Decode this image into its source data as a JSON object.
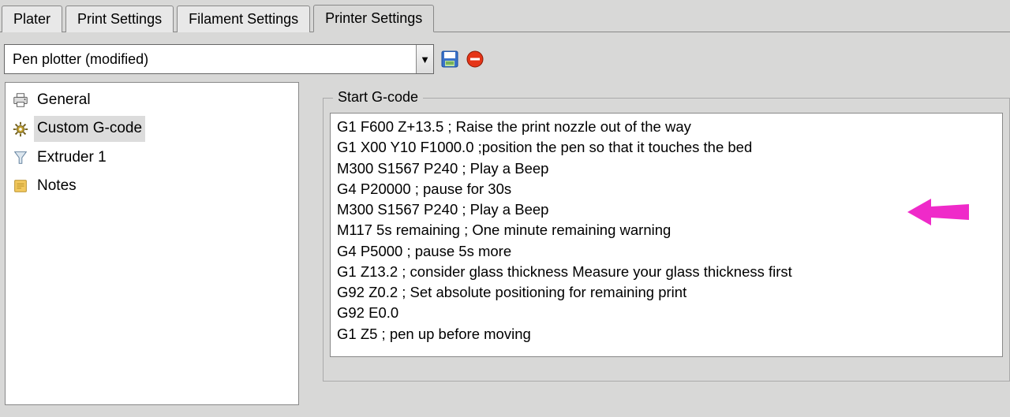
{
  "tabs": {
    "plater": "Plater",
    "print_settings": "Print Settings",
    "filament_settings": "Filament Settings",
    "printer_settings": "Printer Settings"
  },
  "profile": {
    "selected": "Pen plotter (modified)"
  },
  "tree": {
    "general": "General",
    "custom_gcode": "Custom G-code",
    "extruder1": "Extruder 1",
    "notes": "Notes"
  },
  "groupbox": {
    "legend": "Start G-code"
  },
  "gcode": "G1 F600 Z+13.5 ; Raise the print nozzle out of the way\nG1 X00 Y10 F1000.0 ;position the pen so that it touches the bed\nM300 S1567 P240 ; Play a Beep\nG4 P20000 ; pause for 30s\nM300 S1567 P240 ; Play a Beep\nM117 5s remaining ; One minute remaining warning\nG4 P5000 ; pause 5s more\nG1 Z13.2 ; consider glass thickness Measure your glass thickness first\nG92 Z0.2 ; Set absolute positioning for remaining print\nG92 E0.0\nG1 Z5 ; pen up before moving"
}
